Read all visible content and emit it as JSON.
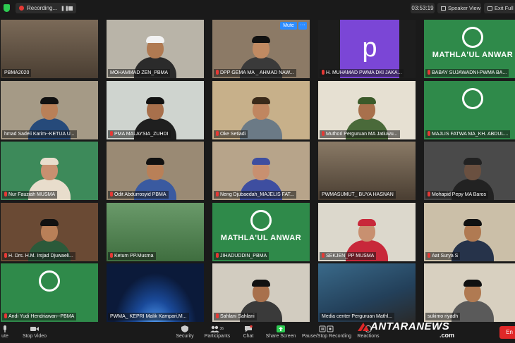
{
  "topbar": {
    "recording_label": "Recording...",
    "timer": "03:53:19",
    "speaker_view_label": "Speaker View",
    "exit_fullscreen_label": "Exit Full Screen"
  },
  "tiles": [
    {
      "name": "PBMA2020",
      "muted": false,
      "kind": "room",
      "bg": "#7b6a58"
    },
    {
      "name": "MOHAMMAD ZEN_PBMA",
      "muted": false,
      "kind": "person",
      "bg": "#b9b4a8",
      "skin": "#b07a52",
      "cap": "#f2f2f2",
      "body": "#2b2b2b"
    },
    {
      "name": "DPP GEMA MA _ AHMAD NAW...",
      "muted": true,
      "kind": "person",
      "bg": "#8c7a66",
      "skin": "#c08a62",
      "cap": "#111111",
      "body": "#3a3a3a",
      "active": true,
      "mute_label": "Mute",
      "more_label": "···"
    },
    {
      "name": "H. MUHAMAD PWMA DKI JAKA...",
      "muted": true,
      "kind": "avatar",
      "letter": "p",
      "bg": "#1d1d1d"
    },
    {
      "name": "BABAY SUJAWADNI-PWMA BA...",
      "muted": true,
      "kind": "banner",
      "bg": "#2f8a4a",
      "banner": "MATHLA'UL ANWAR"
    },
    {
      "name": "hmad Sadeli Karim--KETUA U...",
      "muted": false,
      "kind": "person",
      "bg": "#a59a86",
      "skin": "#b98058",
      "cap": "#111111",
      "body": "#264a7a"
    },
    {
      "name": "PMA MALAYSIA_ZUHDI",
      "muted": true,
      "kind": "person",
      "bg": "#cfd4cf",
      "skin": "#a8704c",
      "cap": "#111111",
      "body": "#1f1f1f"
    },
    {
      "name": "Oke Setiadi",
      "muted": true,
      "kind": "person",
      "bg": "#c7b08a",
      "skin": "#c08660",
      "cap": "#3a2a1a",
      "body": "#6b7a86"
    },
    {
      "name": "Muthori Perguruan MA Jatiuwu...",
      "muted": true,
      "kind": "person",
      "bg": "#e6e0d2",
      "skin": "#a8704c",
      "cap": "#3b5a2a",
      "body": "#4a6a3a"
    },
    {
      "name": "MAJLIS FATWA MA_KH. ABDUL...",
      "muted": true,
      "kind": "banner",
      "bg": "#2f8a4a",
      "banner": ""
    },
    {
      "name": "Nur Fauziah MUSMA",
      "muted": true,
      "kind": "person",
      "bg": "#3d8a5a",
      "skin": "#c89070",
      "cap": "#e8ddcc",
      "body": "#e8ddcc"
    },
    {
      "name": "Odit Abdurrosyid PBMA",
      "muted": true,
      "kind": "person",
      "bg": "#9a8a74",
      "skin": "#b98058",
      "cap": "#111111",
      "body": "#3a5aa0"
    },
    {
      "name": "Neng Djubaedah_MAJELIS FAT...",
      "muted": true,
      "kind": "person",
      "bg": "#b7a48a",
      "skin": "#c89070",
      "cap": "#3e4ea0",
      "body": "#3e4ea0"
    },
    {
      "name": "PWMASUMUT_ BUYA HASNAN",
      "muted": false,
      "kind": "room",
      "bg": "#8a7a66"
    },
    {
      "name": "Mohapid Pepy MA Baros",
      "muted": true,
      "kind": "person",
      "bg": "#4a4a4a",
      "skin": "#6a5040",
      "cap": "#222222",
      "body": "#222222"
    },
    {
      "name": "H. Drs. H.M. Irsjad Djuwaeli...",
      "muted": true,
      "kind": "person",
      "bg": "#6a4a34",
      "skin": "#b98058",
      "cap": "#111111",
      "body": "#2b5a3a"
    },
    {
      "name": "Ketum PP.Musma",
      "muted": true,
      "kind": "nature",
      "bg": "#4a7a4a"
    },
    {
      "name": "JIHADUDDIN_PBMA",
      "muted": true,
      "kind": "banner",
      "bg": "#2f8a4a",
      "banner": "MATHLA'UL ANWAR"
    },
    {
      "name": "SEKJEN_PP MUSMA",
      "muted": true,
      "kind": "person",
      "bg": "#dcd8cc",
      "skin": "#c89070",
      "cap": "#c8283a",
      "body": "#c8283a"
    },
    {
      "name": "Aat Surya S",
      "muted": true,
      "kind": "person",
      "bg": "#cbbfa8",
      "skin": "#b07a52",
      "cap": "#111111",
      "body": "#26334a"
    },
    {
      "name": "Andi Yudi Hendriawan--PBMA",
      "muted": true,
      "kind": "banner",
      "bg": "#2f8a4a",
      "banner": ""
    },
    {
      "name": "PWMA_ KEPRI Malik Kampari,M...",
      "muted": false,
      "kind": "space",
      "bg": "#0b1a3a"
    },
    {
      "name": "Sahlani Sahlani",
      "muted": true,
      "kind": "person",
      "bg": "#d2ccc0",
      "skin": "#a8704c",
      "cap": "#111111",
      "body": "#3a3a3a"
    },
    {
      "name": "Media center Perguruan Mathl...",
      "muted": false,
      "kind": "screen",
      "bg": "#23405a"
    },
    {
      "name": "sukimo riyadh",
      "muted": false,
      "kind": "person",
      "bg": "#d8d0c0",
      "skin": "#b07a52",
      "cap": "#111111",
      "body": "#5a5a5a"
    }
  ],
  "toolbar": {
    "mute_label": "ute",
    "stop_video_label": "Stop Video",
    "security_label": "Security",
    "participants_label": "Participants",
    "participants_count": "36",
    "chat_label": "Chat",
    "share_screen_label": "Share Screen",
    "pause_recording_label": "Pause/Stop Recording",
    "reactions_label": "Reactions",
    "end_label": "En"
  },
  "watermark": {
    "main": "ANTARANEWS",
    "sub": ".com"
  },
  "colors": {
    "accent_green": "#2ecc52",
    "mute_blue": "#2d8cff",
    "record_red": "#e53935",
    "active_outline": "#c9e05a",
    "end_red": "#e02828"
  }
}
